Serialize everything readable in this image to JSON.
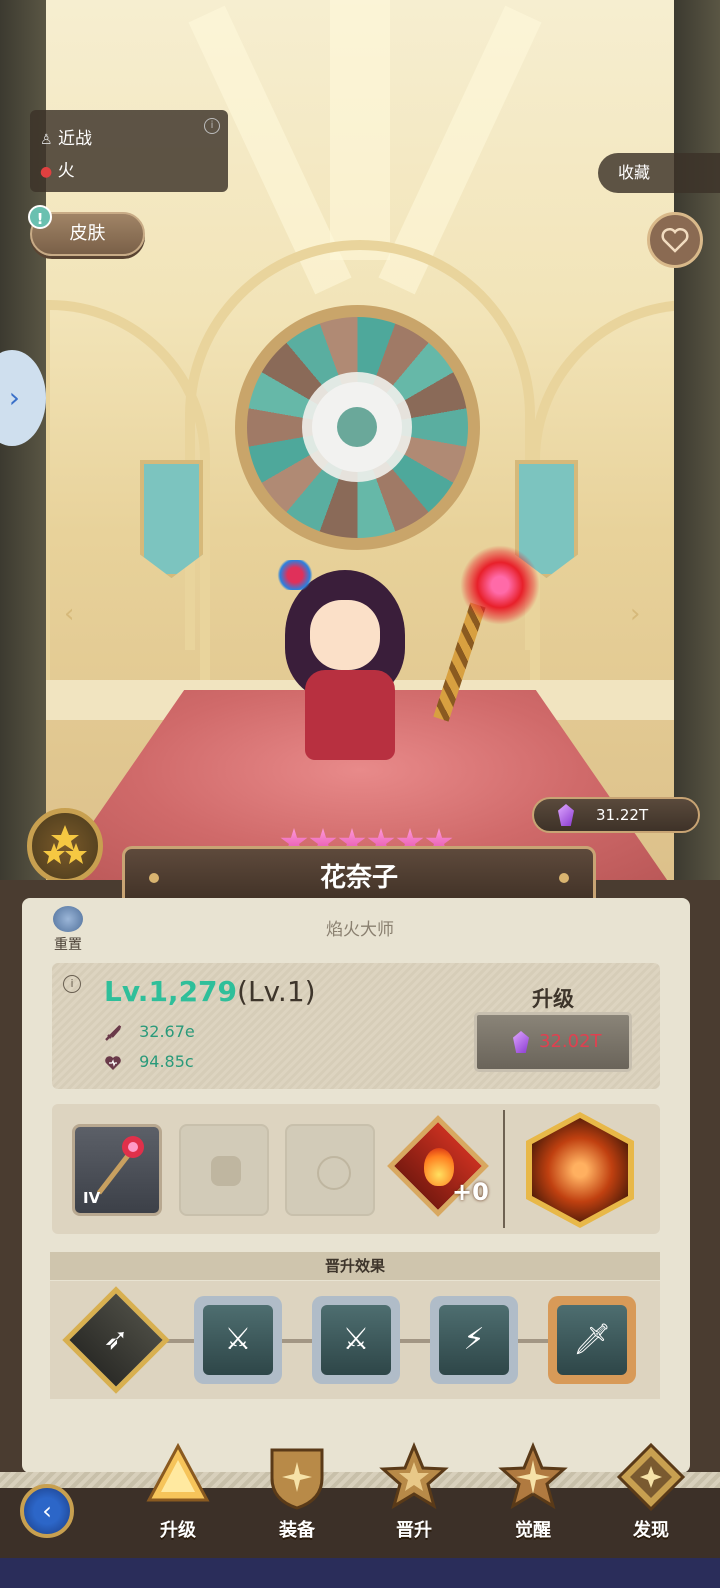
{
  "hero": {
    "attack_type": "近战",
    "element": "火",
    "name": "花奈子",
    "title": "焰火大师",
    "star_count": 6,
    "grade_stars": 3
  },
  "top": {
    "skin_label": "皮肤",
    "skin_alert": "!",
    "collect_label": "收藏"
  },
  "currency": {
    "amount": "31.22T"
  },
  "stats": {
    "level": "Lv.1,279",
    "base_level": "(Lv.1)",
    "attack": "32.67e",
    "health": "94.85c"
  },
  "upgrade": {
    "title": "升级",
    "cost": "32.02T"
  },
  "reset": {
    "label": "重置"
  },
  "equipment": {
    "weapon_tier": "IV",
    "rune_level": "+0"
  },
  "promotion": {
    "header": "晋升效果"
  },
  "nav": {
    "items": [
      {
        "label": "升级"
      },
      {
        "label": "装备"
      },
      {
        "label": "晋升"
      },
      {
        "label": "觉醒"
      },
      {
        "label": "发现"
      }
    ]
  },
  "colors": {
    "level_green": "#2fbf9a",
    "stat_green": "#2a9a7a",
    "cost_red": "#e04050",
    "star_pink": "#e04aa8"
  }
}
